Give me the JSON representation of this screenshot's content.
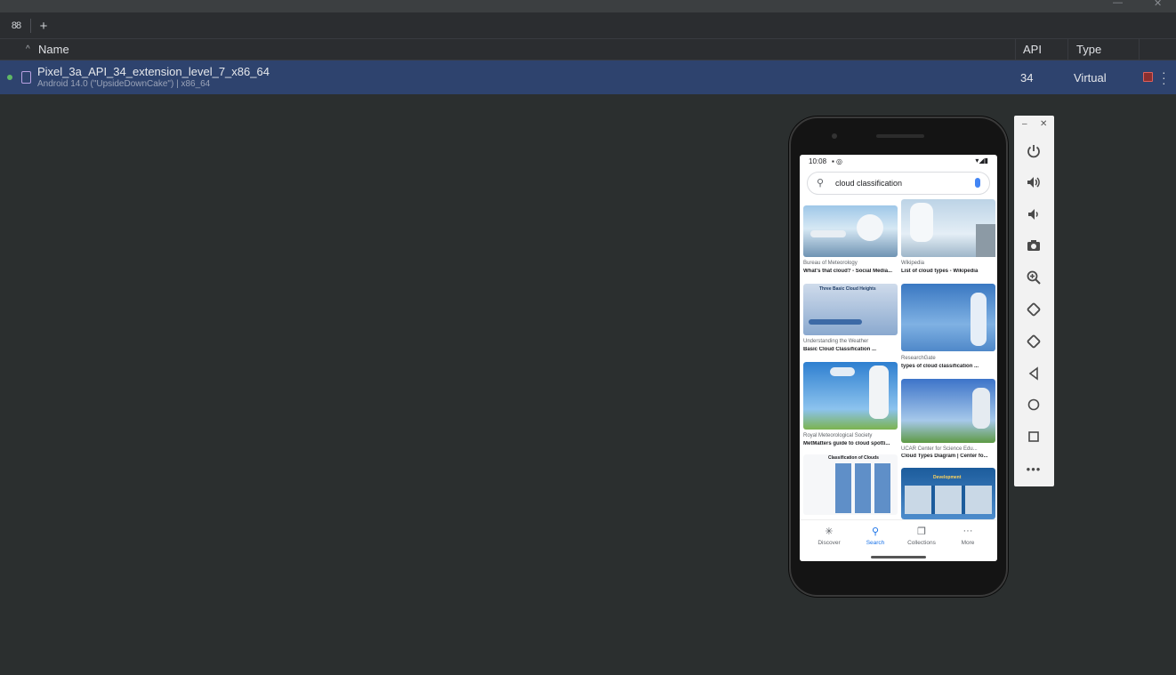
{
  "window": {
    "minimize_glyph": "—",
    "close_glyph": "✕"
  },
  "toolbar": {
    "device_manager_icon": "88",
    "add_icon": "+"
  },
  "table": {
    "sort_indicator": "^",
    "columns": {
      "name": "Name",
      "api": "API",
      "type": "Type"
    },
    "rows": [
      {
        "name": "Pixel_3a_API_34_extension_level_7_x86_64",
        "subtitle": "Android 14.0 (\"UpsideDownCake\") | x86_64",
        "api": "34",
        "type": "Virtual",
        "status": "running"
      }
    ]
  },
  "phone": {
    "status_time": "10:08",
    "status_left_icons": "▪ ◎",
    "status_right_icons": "▾◢▮",
    "search": {
      "query": "cloud classification"
    },
    "results": [
      {
        "source": "Bureau of Meteorology",
        "caption": "What's that cloud? - Social Media..."
      },
      {
        "source": "Wikipedia",
        "caption": "List of cloud types - Wikipedia"
      },
      {
        "source": "Understanding the Weather",
        "caption": "Basic Cloud Classification ..."
      },
      {
        "source": "ResearchGate",
        "caption": "types of cloud classification ..."
      },
      {
        "source": "Royal Meteorological Society",
        "caption": "MetMatters guide to cloud spotti..."
      },
      {
        "source": "UCAR Center for Science Edu...",
        "caption": "Cloud Types Diagram | Center fo..."
      },
      {
        "inner_title": "Classification of Clouds"
      },
      {
        "inner_title": "Development"
      }
    ],
    "image_inner_text": {
      "cloud_heights": "Three Basic Cloud Heights"
    },
    "nav": [
      {
        "label": "Discover",
        "icon": "✳"
      },
      {
        "label": "Search",
        "icon": "⚲"
      },
      {
        "label": "Collections",
        "icon": "❐"
      },
      {
        "label": "More",
        "icon": "···"
      }
    ]
  },
  "emulator_controls": {
    "icons": [
      "power-icon",
      "volume-up-icon",
      "volume-down-icon",
      "camera-icon",
      "zoom-icon",
      "rotate-left-icon",
      "rotate-right-icon",
      "back-icon",
      "home-icon",
      "overview-icon",
      "more-icon"
    ]
  },
  "colors": {
    "selected_row": "#2e436e",
    "running_dot": "#5fb865",
    "google_blue": "#1a73e8"
  }
}
